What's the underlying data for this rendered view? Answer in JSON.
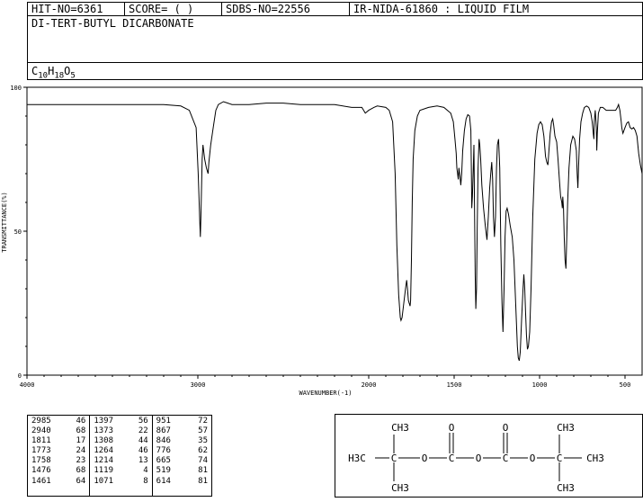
{
  "header": {
    "hit_no": "HIT-NO=6361",
    "score": "SCORE=  (   )",
    "sdbs_no": "SDBS-NO=22556",
    "ir_nida": "IR-NIDA-61860 : LIQUID FILM"
  },
  "compound_name": "DI-TERT-BUTYL DICARBONATE",
  "formula": {
    "c": "C",
    "c_n": "10",
    "h": "H",
    "h_n": "18",
    "o": "O",
    "o_n": "5"
  },
  "chart_data": {
    "type": "line",
    "xlabel": "WAVENUMBER(-1)",
    "ylabel": "TRANSMITTANCE(%)",
    "xlim": [
      4000,
      400
    ],
    "ylim": [
      0,
      100
    ],
    "x_ticks": [
      4000,
      3000,
      2000,
      1500,
      1000,
      500
    ],
    "y_ticks": [
      100,
      50,
      0
    ],
    "x_tick_labels": [
      "4000",
      "3000",
      "2000",
      "1500",
      "1000",
      "500"
    ],
    "y_tick_labels": [
      "100",
      "50",
      "0"
    ],
    "series": [
      {
        "points": [
          [
            4000,
            94
          ],
          [
            3800,
            94
          ],
          [
            3600,
            94
          ],
          [
            3400,
            94
          ],
          [
            3200,
            94
          ],
          [
            3100,
            93.5
          ],
          [
            3050,
            92
          ],
          [
            3010,
            86
          ],
          [
            2998,
            70
          ],
          [
            2988,
            52
          ],
          [
            2985,
            48
          ],
          [
            2982,
            55
          ],
          [
            2975,
            75
          ],
          [
            2970,
            80
          ],
          [
            2960,
            75
          ],
          [
            2950,
            72
          ],
          [
            2940,
            70
          ],
          [
            2935,
            74
          ],
          [
            2925,
            80
          ],
          [
            2910,
            86
          ],
          [
            2895,
            92
          ],
          [
            2880,
            94
          ],
          [
            2850,
            95
          ],
          [
            2800,
            94
          ],
          [
            2700,
            94
          ],
          [
            2600,
            94.5
          ],
          [
            2500,
            94.5
          ],
          [
            2400,
            94
          ],
          [
            2300,
            94
          ],
          [
            2200,
            94
          ],
          [
            2100,
            93
          ],
          [
            2040,
            93
          ],
          [
            2020,
            91
          ],
          [
            2000,
            92
          ],
          [
            1970,
            93
          ],
          [
            1950,
            93.5
          ],
          [
            1900,
            93
          ],
          [
            1880,
            92
          ],
          [
            1860,
            88
          ],
          [
            1845,
            70
          ],
          [
            1835,
            45
          ],
          [
            1825,
            28
          ],
          [
            1815,
            20
          ],
          [
            1811,
            19
          ],
          [
            1805,
            20
          ],
          [
            1795,
            25
          ],
          [
            1785,
            30
          ],
          [
            1778,
            33
          ],
          [
            1773,
            30
          ],
          [
            1768,
            26
          ],
          [
            1763,
            25
          ],
          [
            1758,
            24
          ],
          [
            1755,
            26
          ],
          [
            1750,
            40
          ],
          [
            1745,
            60
          ],
          [
            1740,
            75
          ],
          [
            1730,
            85
          ],
          [
            1715,
            90
          ],
          [
            1700,
            92
          ],
          [
            1650,
            93
          ],
          [
            1600,
            93.5
          ],
          [
            1560,
            93
          ],
          [
            1520,
            91
          ],
          [
            1505,
            88
          ],
          [
            1495,
            82
          ],
          [
            1488,
            77
          ],
          [
            1484,
            72
          ],
          [
            1480,
            70
          ],
          [
            1476,
            68
          ],
          [
            1472,
            72
          ],
          [
            1466,
            69
          ],
          [
            1461,
            66
          ],
          [
            1456,
            70
          ],
          [
            1450,
            78
          ],
          [
            1440,
            85
          ],
          [
            1430,
            89
          ],
          [
            1420,
            90.5
          ],
          [
            1410,
            90
          ],
          [
            1402,
            85
          ],
          [
            1399,
            70
          ],
          [
            1397,
            58
          ],
          [
            1393,
            62
          ],
          [
            1388,
            72
          ],
          [
            1384,
            80
          ],
          [
            1381,
            60
          ],
          [
            1377,
            35
          ],
          [
            1373,
            23
          ],
          [
            1369,
            30
          ],
          [
            1365,
            50
          ],
          [
            1360,
            72
          ],
          [
            1354,
            82
          ],
          [
            1350,
            80
          ],
          [
            1345,
            75
          ],
          [
            1338,
            66
          ],
          [
            1328,
            58
          ],
          [
            1318,
            52
          ],
          [
            1308,
            47
          ],
          [
            1300,
            55
          ],
          [
            1292,
            65
          ],
          [
            1286,
            70
          ],
          [
            1280,
            74
          ],
          [
            1275,
            68
          ],
          [
            1270,
            55
          ],
          [
            1264,
            48
          ],
          [
            1258,
            55
          ],
          [
            1252,
            72
          ],
          [
            1247,
            80
          ],
          [
            1240,
            82
          ],
          [
            1233,
            72
          ],
          [
            1227,
            45
          ],
          [
            1220,
            25
          ],
          [
            1214,
            15
          ],
          [
            1208,
            30
          ],
          [
            1202,
            48
          ],
          [
            1196,
            57
          ],
          [
            1190,
            58
          ],
          [
            1182,
            56
          ],
          [
            1172,
            52
          ],
          [
            1160,
            48
          ],
          [
            1150,
            40
          ],
          [
            1140,
            25
          ],
          [
            1130,
            10
          ],
          [
            1125,
            6
          ],
          [
            1119,
            5
          ],
          [
            1113,
            8
          ],
          [
            1105,
            20
          ],
          [
            1097,
            30
          ],
          [
            1092,
            35
          ],
          [
            1087,
            30
          ],
          [
            1082,
            22
          ],
          [
            1077,
            14
          ],
          [
            1071,
            9
          ],
          [
            1065,
            10
          ],
          [
            1058,
            15
          ],
          [
            1050,
            30
          ],
          [
            1040,
            55
          ],
          [
            1028,
            75
          ],
          [
            1015,
            84
          ],
          [
            1005,
            87
          ],
          [
            995,
            88
          ],
          [
            985,
            87
          ],
          [
            975,
            83
          ],
          [
            965,
            76
          ],
          [
            958,
            74
          ],
          [
            951,
            73
          ],
          [
            945,
            78
          ],
          [
            938,
            84
          ],
          [
            930,
            88
          ],
          [
            923,
            89
          ],
          [
            918,
            87
          ],
          [
            910,
            83
          ],
          [
            900,
            81
          ],
          [
            892,
            75
          ],
          [
            884,
            68
          ],
          [
            877,
            62
          ],
          [
            870,
            60
          ],
          [
            867,
            58
          ],
          [
            864,
            62
          ],
          [
            860,
            58
          ],
          [
            856,
            48
          ],
          [
            851,
            40
          ],
          [
            846,
            37
          ],
          [
            842,
            45
          ],
          [
            836,
            60
          ],
          [
            828,
            72
          ],
          [
            818,
            80
          ],
          [
            805,
            83
          ],
          [
            795,
            82
          ],
          [
            785,
            78
          ],
          [
            780,
            70
          ],
          [
            776,
            65
          ],
          [
            772,
            72
          ],
          [
            766,
            82
          ],
          [
            758,
            88
          ],
          [
            748,
            91
          ],
          [
            738,
            93
          ],
          [
            725,
            93.5
          ],
          [
            712,
            93
          ],
          [
            700,
            91
          ],
          [
            692,
            88
          ],
          [
            686,
            84
          ],
          [
            682,
            82
          ],
          [
            680,
            88
          ],
          [
            674,
            92
          ],
          [
            668,
            86
          ],
          [
            665,
            78
          ],
          [
            662,
            84
          ],
          [
            656,
            91
          ],
          [
            645,
            93
          ],
          [
            630,
            93
          ],
          [
            610,
            92
          ],
          [
            590,
            92
          ],
          [
            570,
            92
          ],
          [
            555,
            92
          ],
          [
            545,
            93
          ],
          [
            538,
            94
          ],
          [
            530,
            92
          ],
          [
            522,
            88
          ],
          [
            519,
            86
          ],
          [
            516,
            85
          ],
          [
            512,
            84
          ],
          [
            500,
            86
          ],
          [
            490,
            87.5
          ],
          [
            480,
            88
          ],
          [
            470,
            86
          ],
          [
            460,
            85.5
          ],
          [
            450,
            86
          ],
          [
            440,
            85
          ],
          [
            430,
            83
          ],
          [
            420,
            77
          ],
          [
            410,
            73
          ],
          [
            400,
            70
          ]
        ]
      }
    ]
  },
  "peak_table": [
    [
      "2985",
      "46",
      "1397",
      "56",
      "951",
      "72"
    ],
    [
      "2940",
      "68",
      "1373",
      "22",
      "867",
      "57"
    ],
    [
      "1811",
      "17",
      "1308",
      "44",
      "846",
      "35"
    ],
    [
      "1773",
      "24",
      "1264",
      "46",
      "776",
      "62"
    ],
    [
      "1758",
      "23",
      "1214",
      "13",
      "665",
      "74"
    ],
    [
      "1476",
      "68",
      "1119",
      "4",
      "519",
      "81"
    ],
    [
      "1461",
      "64",
      "1071",
      "8",
      "614",
      "81"
    ]
  ],
  "structure": {
    "left_carbon": "H3C",
    "ch3_top": "CH3",
    "ch3_bottom": "CH3",
    "o_atom": "O",
    "c_atom": "C",
    "right_methyl": "CH3"
  }
}
